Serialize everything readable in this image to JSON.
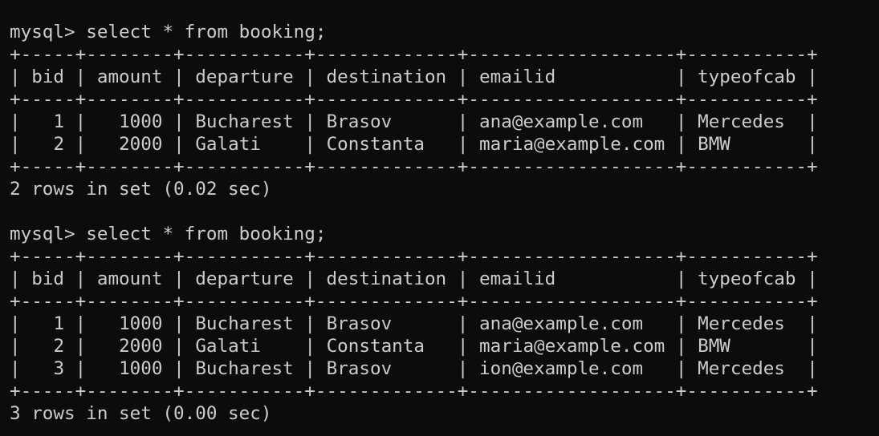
{
  "terminal": {
    "blocks": [
      {
        "prompt": "mysql>",
        "command": "select * from booking;",
        "columns": [
          "bid",
          "amount",
          "departure",
          "destination",
          "emailid",
          "typeofcab"
        ],
        "rows": [
          [
            "1",
            "1000",
            "Bucharest",
            "Brasov",
            "ana@example.com",
            "Mercedes"
          ],
          [
            "2",
            "2000",
            "Galati",
            "Constanta",
            "maria@example.com",
            "BMW"
          ]
        ],
        "footer": "2 rows in set (0.02 sec)"
      },
      {
        "prompt": "mysql>",
        "command": "select * from booking;",
        "columns": [
          "bid",
          "amount",
          "departure",
          "destination",
          "emailid",
          "typeofcab"
        ],
        "rows": [
          [
            "1",
            "1000",
            "Bucharest",
            "Brasov",
            "ana@example.com",
            "Mercedes"
          ],
          [
            "2",
            "2000",
            "Galati",
            "Constanta",
            "maria@example.com",
            "BMW"
          ],
          [
            "3",
            "1000",
            "Bucharest",
            "Brasov",
            "ion@example.com",
            "Mercedes"
          ]
        ],
        "footer": "3 rows in set (0.00 sec)"
      }
    ]
  }
}
